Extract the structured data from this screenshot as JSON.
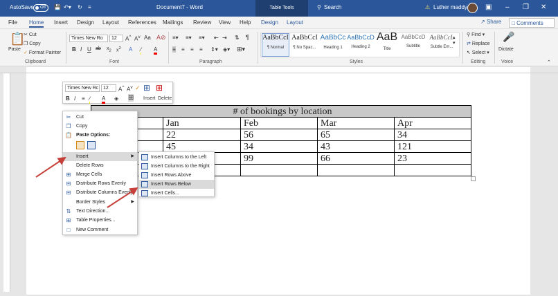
{
  "titlebar": {
    "autosave_label": "AutoSave",
    "autosave_state": "Off",
    "doc_title": "Document7 - Word",
    "context_tab": "Table Tools",
    "search_label": "Search",
    "user_name": "Luther maddy"
  },
  "menu": {
    "tabs": [
      "File",
      "Home",
      "Insert",
      "Design",
      "Layout",
      "References",
      "Mailings",
      "Review",
      "View",
      "Help"
    ],
    "context_tabs": [
      "Design",
      "Layout"
    ],
    "share": "Share",
    "comments": "Comments"
  },
  "ribbon": {
    "clipboard": {
      "paste": "Paste",
      "cut": "Cut",
      "copy": "Copy",
      "format_painter": "Format Painter",
      "group": "Clipboard"
    },
    "font": {
      "name": "Times New Ro",
      "size": "12",
      "group": "Font"
    },
    "paragraph": {
      "group": "Paragraph"
    },
    "styles": {
      "group": "Styles",
      "items": [
        {
          "preview": "AaBbCcI",
          "name": "¶ Normal"
        },
        {
          "preview": "AaBbCcI",
          "name": "¶ No Spac..."
        },
        {
          "preview": "AaBbCc",
          "name": "Heading 1"
        },
        {
          "preview": "AaBbCcD",
          "name": "Heading 2"
        },
        {
          "preview": "AaB",
          "name": "Title"
        },
        {
          "preview": "AaBbCcD",
          "name": "Subtitle"
        },
        {
          "preview": "AaBbCcL",
          "name": "Subtle Em..."
        }
      ]
    },
    "editing": {
      "find": "Find",
      "replace": "Replace",
      "select": "Select",
      "group": "Editing"
    },
    "voice": {
      "dictate": "Dictate",
      "group": "Voice"
    }
  },
  "mini_toolbar": {
    "font": "Times New Rc",
    "size": "12",
    "insert": "Insert",
    "delete": "Delete"
  },
  "table": {
    "title": "# of bookings by location",
    "header": [
      "",
      "Jan",
      "Feb",
      "Mar",
      "Apr"
    ],
    "rows": [
      [
        "",
        "22",
        "56",
        "65",
        "34"
      ],
      [
        "",
        "45",
        "34",
        "43",
        "121"
      ],
      [
        "",
        "",
        "99",
        "66",
        "23"
      ],
      [
        "",
        "",
        "",
        "",
        ""
      ]
    ]
  },
  "context_menu": {
    "items": [
      "Cut",
      "Copy",
      "Paste Options:",
      "Insert",
      "Delete Rows",
      "Merge Cells",
      "Distribute Rows Evenly",
      "Distribute Columns Evenly",
      "Border Styles",
      "Text Direction...",
      "Table Properties...",
      "New Comment"
    ]
  },
  "submenu": {
    "items": [
      "Insert Columns to the Left",
      "Insert Columns to the Right",
      "Insert Rows Above",
      "Insert Rows Below",
      "Insert Cells..."
    ]
  },
  "colors": {
    "word_blue": "#2b579a",
    "arrow_red": "#c8403a",
    "highlight": "#dadada",
    "table_header": "#c8c8c8"
  }
}
